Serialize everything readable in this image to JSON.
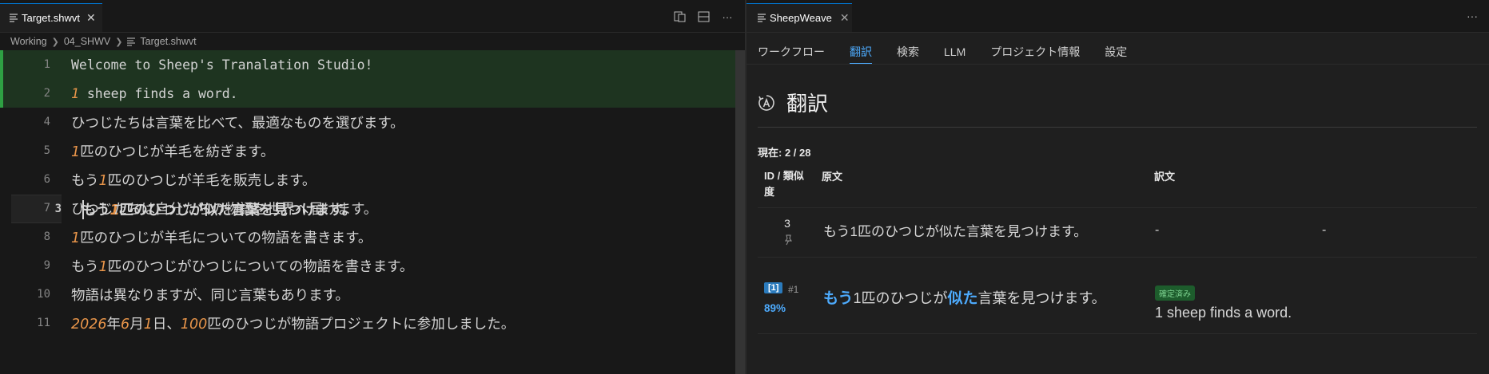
{
  "editor": {
    "tab_label": "Target.shwvt",
    "breadcrumb": [
      "Working",
      "04_SHWV",
      "Target.shwvt"
    ],
    "lines": [
      {
        "num": "1",
        "state": "added",
        "mono": true,
        "segments": [
          {
            "t": "Welcome to Sheep's Tranalation Studio!"
          }
        ]
      },
      {
        "num": "2",
        "state": "added",
        "mono": true,
        "segments": [
          {
            "t": "1",
            "n": true
          },
          {
            "t": " sheep finds a word."
          }
        ]
      },
      {
        "num": "3",
        "state": "current",
        "mono": false,
        "segments": [
          {
            "t": "もう"
          },
          {
            "t": "1",
            "n": true
          },
          {
            "t": "匹のひつじが似た言葉を見つけます。"
          }
        ]
      },
      {
        "num": "4",
        "state": "",
        "mono": false,
        "segments": [
          {
            "t": "ひつじたちは言葉を比べて、最適なものを選びます。"
          }
        ]
      },
      {
        "num": "5",
        "state": "",
        "mono": false,
        "segments": [
          {
            "t": "1",
            "n": true
          },
          {
            "t": "匹のひつじが羊毛を紡ぎます。"
          }
        ]
      },
      {
        "num": "6",
        "state": "",
        "mono": false,
        "segments": [
          {
            "t": "もう"
          },
          {
            "t": "1",
            "n": true
          },
          {
            "t": "匹のひつじが羊毛を販売します。"
          }
        ]
      },
      {
        "num": "7",
        "state": "",
        "mono": false,
        "segments": [
          {
            "t": "ひつじたちは自分たちの物語を世界へ届けます。"
          }
        ]
      },
      {
        "num": "8",
        "state": "",
        "mono": false,
        "segments": [
          {
            "t": "1",
            "n": true
          },
          {
            "t": "匹のひつじが羊毛についての物語を書きます。"
          }
        ]
      },
      {
        "num": "9",
        "state": "",
        "mono": false,
        "segments": [
          {
            "t": "もう"
          },
          {
            "t": "1",
            "n": true
          },
          {
            "t": "匹のひつじがひつじについての物語を書きます。"
          }
        ]
      },
      {
        "num": "10",
        "state": "",
        "mono": false,
        "segments": [
          {
            "t": "物語は異なりますが、同じ言葉もあります。"
          }
        ]
      },
      {
        "num": "11",
        "state": "",
        "mono": false,
        "segments": [
          {
            "t": "2026",
            "n": true
          },
          {
            "t": "年"
          },
          {
            "t": "6",
            "n": true
          },
          {
            "t": "月"
          },
          {
            "t": "1",
            "n": true
          },
          {
            "t": "日、"
          },
          {
            "t": "100",
            "n": true
          },
          {
            "t": "匹のひつじが物語プロジェクトに参加しました。"
          }
        ]
      }
    ]
  },
  "panel": {
    "tab_label": "SheepWeave",
    "nav_tabs": [
      "ワークフロー",
      "翻訳",
      "検索",
      "LLM",
      "プロジェクト情報",
      "設定"
    ],
    "active_tab": "翻訳",
    "section_title": "翻訳",
    "current_label": "現在: 2 / 28",
    "table": {
      "headers": {
        "id": "ID / 類似度",
        "source": "原文",
        "target": "訳文"
      },
      "row1": {
        "id": "3",
        "source": "もう1匹のひつじが似た言葉を見つけます。",
        "target_a": "-",
        "target_b": "-"
      },
      "row2": {
        "badge": "[1]",
        "index": "#1",
        "similarity": "89%",
        "source_segments": [
          {
            "t": "もう",
            "h": true
          },
          {
            "t": "1匹のひつじが"
          },
          {
            "t": "似た",
            "h": true
          },
          {
            "t": "言葉を見つけます。"
          }
        ],
        "status": "確定済み",
        "target": "1 sheep finds a word."
      }
    }
  },
  "colors": {
    "accent": "#4daafc",
    "number": "#e8954a",
    "added_line": "#1e3420",
    "status_bg": "#1d5c2c"
  },
  "icons": [
    "file-icon",
    "close-icon",
    "chevron-right-icon",
    "split-editor-icon",
    "layout-icon",
    "more-icon",
    "translate-icon",
    "pin-icon"
  ]
}
